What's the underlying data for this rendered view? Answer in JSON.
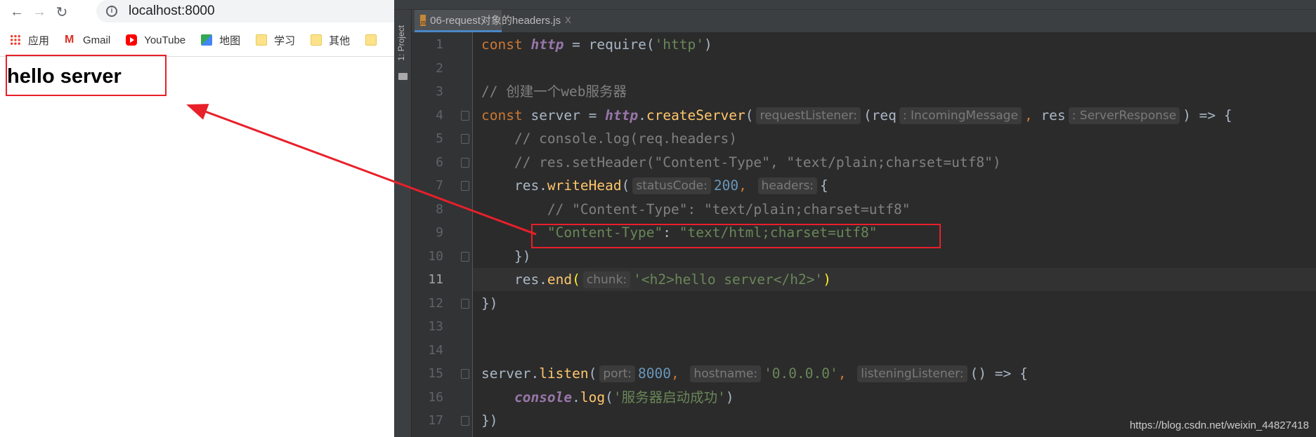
{
  "browser": {
    "url": "localhost:8000",
    "nav_icons": [
      "back-arrow-icon",
      "forward-arrow-icon",
      "reload-icon"
    ],
    "bookmarks": [
      {
        "label": "应用",
        "icon": "apps-grid-icon"
      },
      {
        "label": "Gmail",
        "icon": "gmail-icon"
      },
      {
        "label": "YouTube",
        "icon": "youtube-icon"
      },
      {
        "label": "地图",
        "icon": "maps-icon"
      },
      {
        "label": "学习",
        "icon": "folder-icon"
      },
      {
        "label": "其他",
        "icon": "folder-icon"
      }
    ],
    "page_heading": "hello server"
  },
  "ide": {
    "project_label": "1: Project",
    "tab_label": "06-request对象的headers.js",
    "tab_close": "X",
    "current_line": 11,
    "lines": [
      {
        "n": "1",
        "tokens": [
          {
            "c": "kw",
            "t": "const "
          },
          {
            "c": "var",
            "t": "http"
          },
          {
            "c": "p",
            "t": " = require("
          },
          {
            "c": "str",
            "t": "'http'"
          },
          {
            "c": "p",
            "t": ")"
          }
        ]
      },
      {
        "n": "2",
        "tokens": []
      },
      {
        "n": "3",
        "tokens": [
          {
            "c": "cm",
            "t": "// 创建一个web服务器"
          }
        ]
      },
      {
        "n": "4",
        "tokens": [
          {
            "c": "kw",
            "t": "const "
          },
          {
            "c": "p",
            "t": "server = "
          },
          {
            "c": "var",
            "t": "http"
          },
          {
            "c": "p",
            "t": "."
          },
          {
            "c": "fn",
            "t": "createServer"
          },
          {
            "c": "p",
            "t": "("
          },
          {
            "c": "hint",
            "t": "requestListener:"
          },
          {
            "c": "p",
            "t": "(req"
          },
          {
            "c": "hint",
            "t": ": IncomingMessage"
          },
          {
            "c": "kw",
            "t": ", "
          },
          {
            "c": "p",
            "t": "res"
          },
          {
            "c": "hint",
            "t": ": ServerResponse"
          },
          {
            "c": "p",
            "t": ") => {"
          }
        ]
      },
      {
        "n": "5",
        "tokens": [
          {
            "c": "cm",
            "t": "    // console.log(req.headers)"
          }
        ]
      },
      {
        "n": "6",
        "tokens": [
          {
            "c": "cm",
            "t": "    // res.setHeader(\"Content-Type\", \"text/plain;charset=utf8\")"
          }
        ]
      },
      {
        "n": "7",
        "tokens": [
          {
            "c": "p",
            "t": "    res."
          },
          {
            "c": "fn",
            "t": "writeHead"
          },
          {
            "c": "p",
            "t": "("
          },
          {
            "c": "hint",
            "t": "statusCode:"
          },
          {
            "c": "num",
            "t": "200"
          },
          {
            "c": "kw",
            "t": ", "
          },
          {
            "c": "hint",
            "t": "headers:"
          },
          {
            "c": "p",
            "t": "{"
          }
        ]
      },
      {
        "n": "8",
        "tokens": [
          {
            "c": "cm",
            "t": "        // \"Content-Type\": \"text/plain;charset=utf8\""
          }
        ]
      },
      {
        "n": "9",
        "tokens": [
          {
            "c": "str",
            "t": "        \"Content-Type\""
          },
          {
            "c": "p",
            "t": ": "
          },
          {
            "c": "str",
            "t": "\"text/html;charset=utf8\""
          }
        ]
      },
      {
        "n": "10",
        "tokens": [
          {
            "c": "p",
            "t": "    })"
          }
        ]
      },
      {
        "n": "11",
        "tokens": [
          {
            "c": "p",
            "t": "    res."
          },
          {
            "c": "fn",
            "t": "end"
          },
          {
            "c": "pm",
            "t": "("
          },
          {
            "c": "hint",
            "t": "chunk:"
          },
          {
            "c": "str",
            "t": "'<h2>hello server</h2>'"
          },
          {
            "c": "pm",
            "t": ")"
          }
        ]
      },
      {
        "n": "12",
        "tokens": [
          {
            "c": "p",
            "t": "})"
          }
        ]
      },
      {
        "n": "13",
        "tokens": []
      },
      {
        "n": "14",
        "tokens": []
      },
      {
        "n": "15",
        "tokens": [
          {
            "c": "p",
            "t": "server."
          },
          {
            "c": "fn",
            "t": "listen"
          },
          {
            "c": "p",
            "t": "("
          },
          {
            "c": "hint",
            "t": "port:"
          },
          {
            "c": "num",
            "t": "8000"
          },
          {
            "c": "kw",
            "t": ", "
          },
          {
            "c": "hint",
            "t": "hostname:"
          },
          {
            "c": "str",
            "t": "'0.0.0.0'"
          },
          {
            "c": "kw",
            "t": ", "
          },
          {
            "c": "hint",
            "t": "listeningListener:"
          },
          {
            "c": "p",
            "t": "() => {"
          }
        ]
      },
      {
        "n": "16",
        "tokens": [
          {
            "c": "p",
            "t": "    "
          },
          {
            "c": "var",
            "t": "console"
          },
          {
            "c": "p",
            "t": "."
          },
          {
            "c": "fn",
            "t": "log"
          },
          {
            "c": "p",
            "t": "("
          },
          {
            "c": "str",
            "t": "'服务器启动成功'"
          },
          {
            "c": "p",
            "t": ")"
          }
        ]
      },
      {
        "n": "17",
        "tokens": [
          {
            "c": "p",
            "t": "})"
          }
        ]
      }
    ],
    "fold_lines": [
      4,
      5,
      6,
      7,
      10,
      12,
      15,
      17
    ]
  },
  "annotation": {
    "color": "#e8202a"
  },
  "watermark": "https://blog.csdn.net/weixin_44827418"
}
